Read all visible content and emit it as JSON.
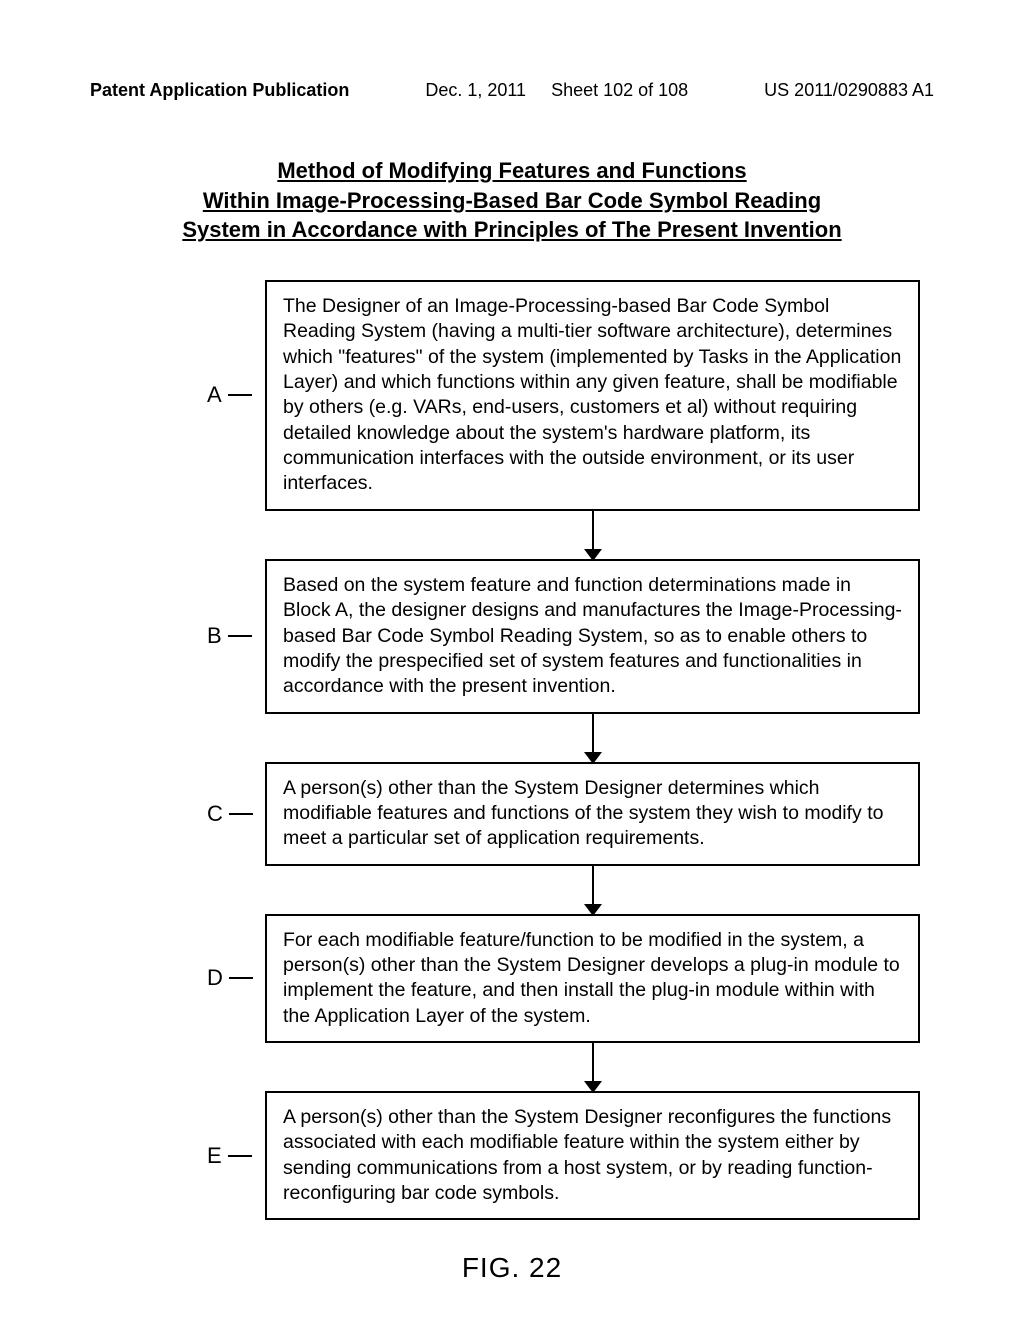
{
  "header": {
    "left": "Patent Application Publication",
    "date": "Dec. 1, 2011",
    "sheet": "Sheet 102 of 108",
    "pubno": "US 2011/0290883 A1"
  },
  "title": {
    "line1": "Method of Modifying Features and Functions",
    "line2": "Within Image-Processing-Based Bar Code Symbol Reading",
    "line3": "System in Accordance with Principles of The Present Invention"
  },
  "steps": [
    {
      "label": "A",
      "text": "The Designer of an Image-Processing-based Bar Code Symbol Reading System (having a multi-tier software architecture), determines which \"features\" of the system (implemented by Tasks in the Application Layer) and which functions within any given feature, shall be modifiable by others (e.g. VARs, end-users, customers et al) without requiring detailed knowledge about the system's hardware platform, its communication interfaces with the outside environment, or its user interfaces."
    },
    {
      "label": "B",
      "text": "Based on the system feature and function determinations made in Block A, the designer designs and manufactures the Image-Processing-based Bar Code Symbol Reading System, so as to enable others to modify the prespecified set of system features and functionalities in accordance with the present invention."
    },
    {
      "label": "C",
      "text": "A person(s) other than the System Designer determines which modifiable features and functions of the system they wish to modify to meet a particular set of application requirements."
    },
    {
      "label": "D",
      "text": "For each modifiable feature/function to be modified in the system, a person(s) other than the System Designer develops a plug-in module to implement the feature, and then install the plug-in module within with the Application Layer of the system."
    },
    {
      "label": "E",
      "text": "A person(s) other than the System Designer reconfigures the functions associated with each modifiable feature within the system either by sending communications from a host system, or by reading function-reconfiguring bar code symbols."
    }
  ],
  "figure_label": "FIG. 22"
}
